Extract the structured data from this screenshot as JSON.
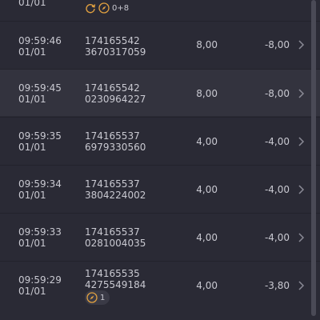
{
  "rows": [
    {
      "time": "",
      "date": "01/01",
      "id_line1": "",
      "id_line2": "",
      "badge_text": "0+8",
      "amount": "",
      "total": ""
    },
    {
      "time": "09:59:46",
      "date": "01/01",
      "id_line1": "174165542",
      "id_line2": "3670317059",
      "amount": "8,00",
      "total": "-8,00"
    },
    {
      "time": "09:59:45",
      "date": "01/01",
      "id_line1": "174165542",
      "id_line2": "0230964227",
      "amount": "8,00",
      "total": "-8,00"
    },
    {
      "time": "09:59:35",
      "date": "01/01",
      "id_line1": "174165537",
      "id_line2": "6979330560",
      "amount": "4,00",
      "total": "-4,00"
    },
    {
      "time": "09:59:34",
      "date": "01/01",
      "id_line1": "174165537",
      "id_line2": "3804224002",
      "amount": "4,00",
      "total": "-4,00"
    },
    {
      "time": "09:59:33",
      "date": "01/01",
      "id_line1": "174165537",
      "id_line2": "0281004035",
      "amount": "4,00",
      "total": "-4,00"
    },
    {
      "time": "09:59:29",
      "date": "01/01",
      "id_line1": "174165535",
      "id_line2": "4275549184",
      "badge_text": "1",
      "amount": "4,00",
      "total": "-3,80"
    }
  ],
  "icons": {
    "chevron": "chevron-right-icon",
    "refresh": "refresh-icon",
    "compass": "compass-icon"
  },
  "colors": {
    "background": "#2a2a35",
    "highlight_row": "#33333e",
    "text": "#c9c9d1",
    "icon_accent": "#e0a040"
  }
}
